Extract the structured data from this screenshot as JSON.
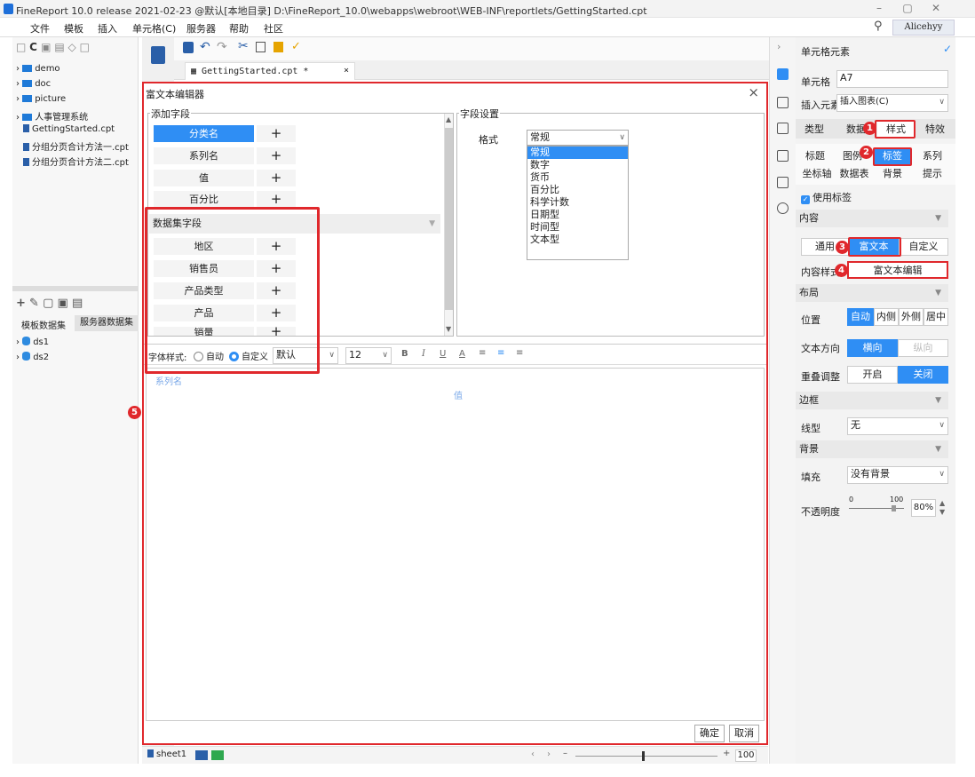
{
  "window": {
    "title": "FineReport 10.0 release 2021-02-23 @默认[本地目录]   D:\\FineReport_10.0\\webapps\\webroot\\WEB-INF\\reportlets/GettingStarted.cpt",
    "minimize": "–",
    "restore": "▢",
    "close": "✕"
  },
  "menu": [
    "文件",
    "模板",
    "插入",
    "单元格(C)",
    "服务器",
    "帮助",
    "社区"
  ],
  "user": "Alicehyy",
  "tree": [
    "demo",
    "doc",
    "picture",
    "人事管理系统",
    "GettingStarted.cpt",
    "分组分页合计方法一.cpt",
    "分组分页合计方法二.cpt"
  ],
  "dataset_tabs": [
    "模板数据集",
    "服务器数据集"
  ],
  "datasets": [
    "ds1",
    "ds2"
  ],
  "doc_tab": "GettingStarted.cpt *",
  "dialog": {
    "title": "富文本编辑器",
    "add_fields_label": "添加字段",
    "fields": [
      "分类名",
      "系列名",
      "值",
      "百分比"
    ],
    "dataset_fields_label": "数据集字段",
    "dataset_fields": [
      "地区",
      "销售员",
      "产品类型",
      "产品",
      "销量"
    ],
    "field_settings_label": "字段设置",
    "format_label": "格式",
    "format_value": "常规",
    "format_options": [
      "常规",
      "数字",
      "货币",
      "百分比",
      "科学计数",
      "日期型",
      "时间型",
      "文本型"
    ],
    "font_style_label": "字体样式:",
    "radio_auto": "自动",
    "radio_custom": "自定义",
    "font_name": "默认",
    "font_size": "12",
    "editor_text1": "系列名",
    "editor_text2": "值",
    "ok": "确定",
    "cancel": "取消"
  },
  "status": {
    "sheet": "sheet1",
    "zoom": "100"
  },
  "right": {
    "header": "单元格元素",
    "cell_label": "单元格",
    "cell_value": "A7",
    "insert_label": "插入元素",
    "insert_value": "插入图表(C)",
    "tabs": [
      "类型",
      "数据",
      "样式",
      "特效"
    ],
    "subtabs_row1": [
      "标题",
      "图例",
      "标签",
      "系列"
    ],
    "subtabs_row2": [
      "坐标轴",
      "数据表",
      "背景",
      "提示"
    ],
    "use_label": "使用标签",
    "content": "内容",
    "content_tabs": [
      "通用",
      "富文本",
      "自定义"
    ],
    "content_style_label": "内容样式",
    "rich_text_edit": "富文本编辑",
    "layout": "布局",
    "position_label": "位置",
    "positions": [
      "自动",
      "内侧",
      "外侧",
      "居中"
    ],
    "text_dir_label": "文本方向",
    "text_dirs": [
      "横向",
      "纵向"
    ],
    "overlap_label": "重叠调整",
    "overlap": [
      "开启",
      "关闭"
    ],
    "border": "边框",
    "line_label": "线型",
    "line_value": "无",
    "background": "背景",
    "fill_label": "填充",
    "fill_value": "没有背景",
    "opacity_label": "不透明度",
    "opacity_min": "0",
    "opacity_max": "100",
    "opacity_value": "80%",
    "opacity_level": 0.8
  },
  "badges": [
    "1",
    "2",
    "3",
    "4",
    "5"
  ],
  "accent": "#2f8ef4",
  "highlight": "#e0282c"
}
